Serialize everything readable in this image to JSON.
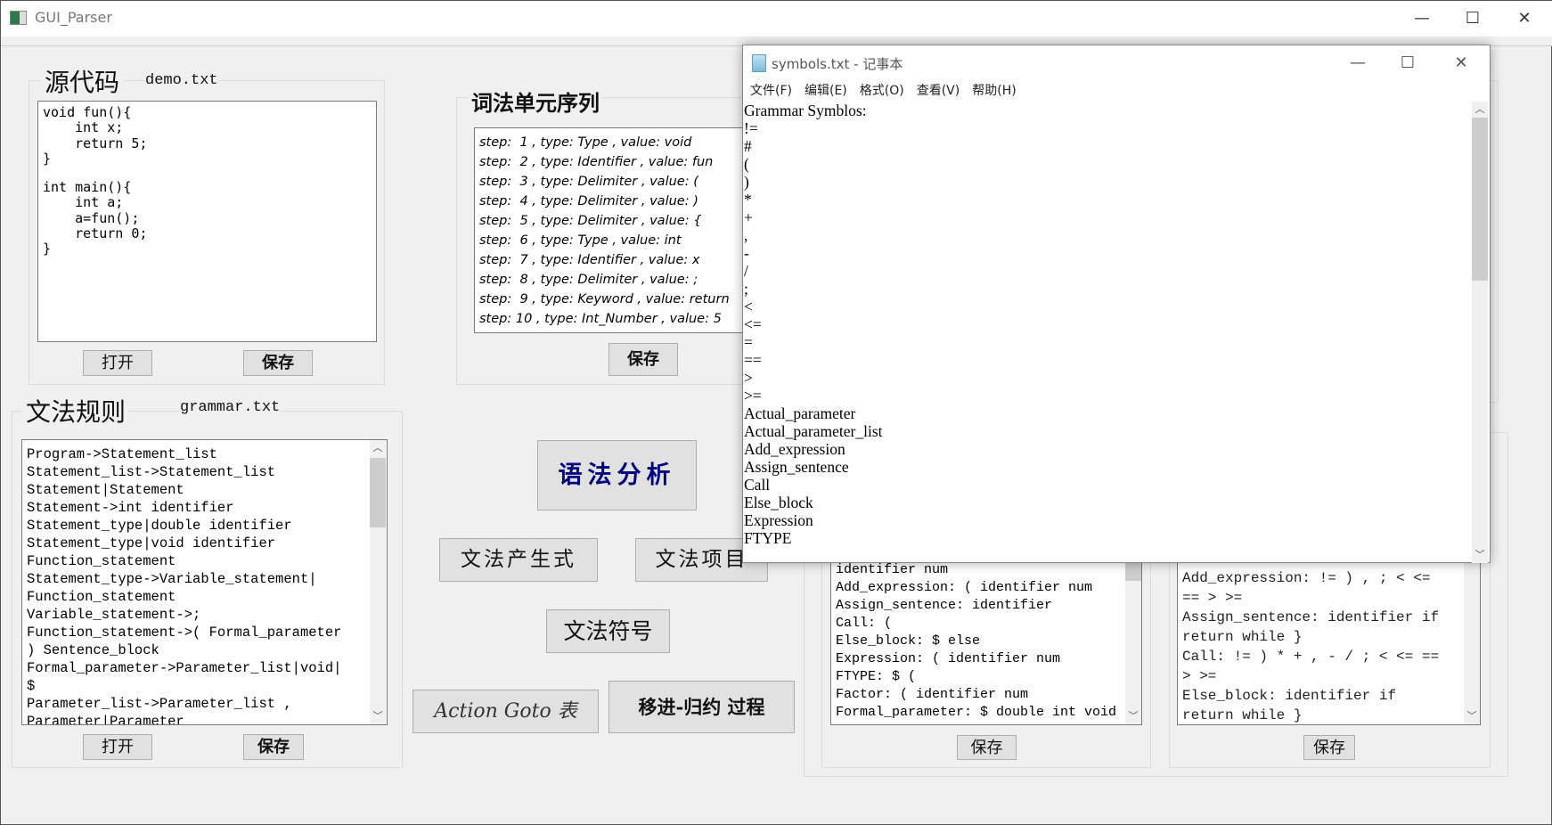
{
  "window": {
    "title": "GUI_Parser",
    "minimize": "—",
    "maximize": "☐",
    "close": "✕"
  },
  "source": {
    "title": "源代码",
    "filename": "demo.txt",
    "lines": [
      "void fun(){",
      "    int x;",
      "    return 5;",
      "}",
      "",
      "int main(){",
      "    int a;",
      "    a=fun();",
      "    return 0;",
      "}"
    ],
    "open": "打开",
    "save": "保存"
  },
  "tokens": {
    "title": "词法单元序列",
    "lines": [
      "step:  1 , type: Type , value: void",
      "step:  2 , type: Identifier , value: fun",
      "step:  3 , type: Delimiter , value: (",
      "step:  4 , type: Delimiter , value: )",
      "step:  5 , type: Delimiter , value: {",
      "step:  6 , type: Type , value: int",
      "step:  7 , type: Identifier , value: x",
      "step:  8 , type: Delimiter , value: ;",
      "step:  9 , type: Keyword , value: return",
      "step: 10 , type: Int_Number , value: 5"
    ],
    "save": "保存"
  },
  "grammar": {
    "title": "文法规则",
    "filename": "grammar.txt",
    "lines": [
      "Program->Statement_list",
      "Statement_list->Statement_list",
      "Statement|Statement",
      "Statement->int identifier",
      "Statement_type|double identifier",
      "Statement_type|void identifier",
      "Function_statement",
      "Statement_type->Variable_statement|",
      "Function_statement",
      "Variable_statement->;",
      "Function_statement->( Formal_parameter",
      ") Sentence_block",
      "Formal_parameter->Parameter_list|void|",
      "$",
      "Parameter_list->Parameter_list ,",
      "Parameter|Parameter"
    ],
    "open": "打开",
    "save": "保存"
  },
  "actions": {
    "analyze": "语法分析",
    "productions": "文法产生式",
    "items": "文法项目",
    "symbols": "文法符号",
    "action_goto": "Action Goto 表",
    "shift_reduce": "移进-归约 过程"
  },
  "first_sets": {
    "lines": [
      "identifier num",
      "Add_expression: ( identifier num",
      "Assign_sentence: identifier",
      "Call: (",
      "Else_block: $ else",
      "Expression: ( identifier num",
      "FTYPE: $ (",
      "Factor: ( identifier num",
      "Formal_parameter: $ double int void"
    ],
    "save": "保存"
  },
  "follow_sets": {
    "lines": [
      "Add_expression: != ) , ; < <=",
      "== > >=",
      "Assign_sentence: identifier if",
      "return while }",
      "Call: != ) * + , - / ; < <= ==",
      "> >=",
      "Else_block: identifier if",
      "return while }"
    ],
    "save": "保存"
  },
  "notepad": {
    "title": "symbols.txt - 记事本",
    "menu": [
      "文件(F)",
      "编辑(E)",
      "格式(O)",
      "查看(V)",
      "帮助(H)"
    ],
    "lines": [
      "Grammar Symblos:",
      "!=",
      "#",
      "(",
      ")",
      "*",
      "+",
      ",",
      "-",
      "/",
      ";",
      "<",
      "<=",
      "=",
      "==",
      ">",
      ">=",
      "Actual_parameter",
      "Actual_parameter_list",
      "Add_expression",
      "Assign_sentence",
      "Call",
      "Else_block",
      "Expression",
      "FTYPE"
    ]
  },
  "colors": {
    "analyze_text": "#000080",
    "background": "#f0f0f0"
  }
}
